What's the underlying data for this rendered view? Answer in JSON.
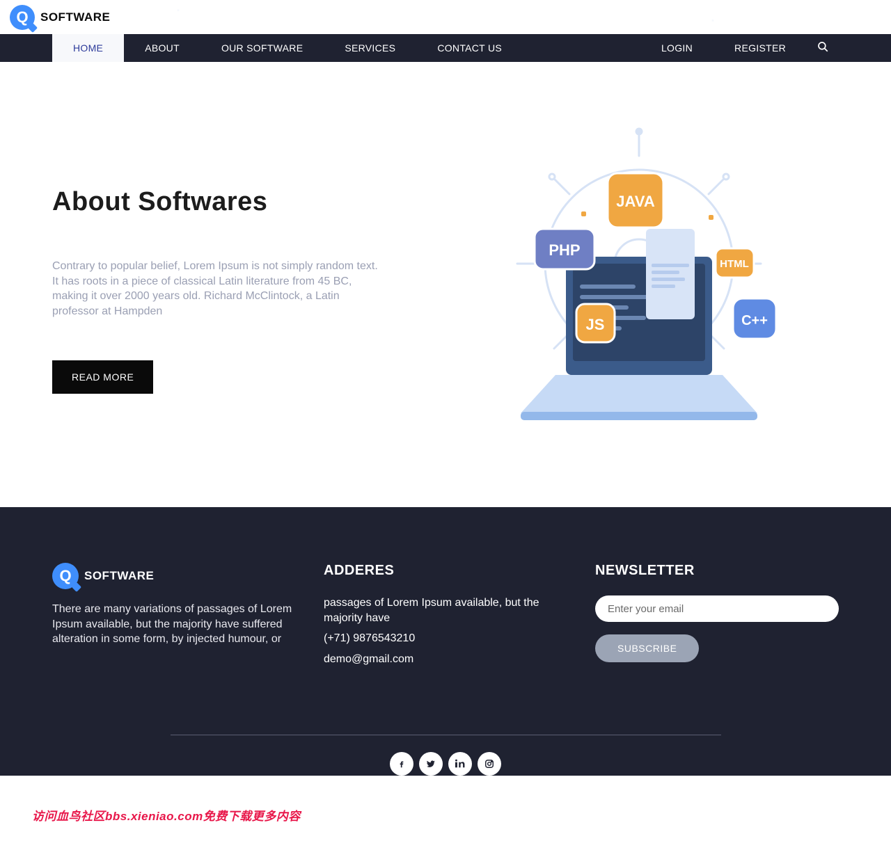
{
  "brand": {
    "name": "SOFTWARE",
    "initial": "Q"
  },
  "nav": {
    "items": [
      {
        "label": "HOME",
        "active": true
      },
      {
        "label": "ABOUT"
      },
      {
        "label": "OUR SOFTWARE"
      },
      {
        "label": "SERVICES"
      },
      {
        "label": "CONTACT US"
      }
    ],
    "right": [
      {
        "label": "LOGIN"
      },
      {
        "label": "REGISTER"
      }
    ]
  },
  "about": {
    "title": "About Softwares",
    "body": "Contrary to popular belief, Lorem Ipsum is not simply random text. It has roots in a piece of classical Latin literature from 45 BC, making it over 2000 years old. Richard McClintock, a Latin professor at Hampden",
    "cta": "READ MORE"
  },
  "illus_langs": {
    "java": "JAVA",
    "php": "PHP",
    "html": "HTML",
    "js": "JS",
    "cpp": "C++"
  },
  "footer": {
    "about_text": "There are many variations of passages of Lorem Ipsum available, but the majority have suffered alteration in some form, by injected humour, or",
    "address": {
      "heading": "ADDERES",
      "line": "passages of Lorem Ipsum available, but the majority have",
      "phone": "(+71) 9876543210",
      "email": "demo@gmail.com"
    },
    "newsletter": {
      "heading": "NEWSLETTER",
      "placeholder": "Enter your email",
      "button": "SUBSCRIBE"
    }
  },
  "watermark": "访问血鸟社区bbs.xieniao.com免费下载更多内容"
}
